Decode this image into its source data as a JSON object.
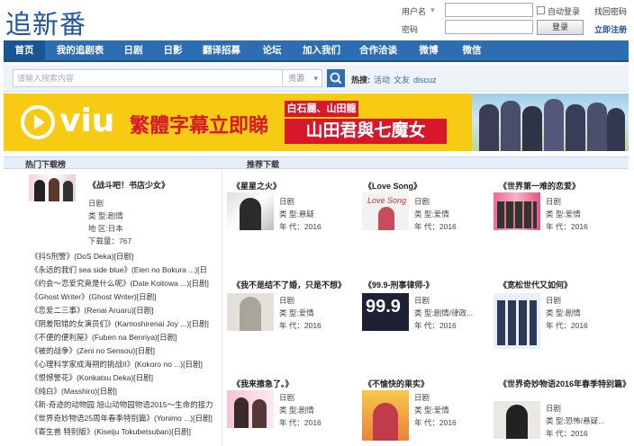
{
  "site": {
    "logo": "追新番"
  },
  "login": {
    "username_label": "用户名",
    "password_label": "密码",
    "remember_label": "自动登录",
    "login_button": "登录",
    "forgot_link": "找回密码",
    "register_link": "立即注册"
  },
  "nav": [
    "首页",
    "我的追剧表",
    "日剧",
    "日影",
    "翻译招募",
    "论坛",
    "加入我们",
    "合作洽谈",
    "微博",
    "微信"
  ],
  "search": {
    "placeholder": "请输入搜索内容",
    "type": "资源",
    "hot_label": "热搜:",
    "hot_terms": [
      "活动",
      "文友",
      "discuz"
    ]
  },
  "banner": {
    "brand": "viu",
    "tagline": "繁體字幕立即睇",
    "cast": "白石麗、山田龍",
    "show_title": "山田君與七魔女"
  },
  "sections": {
    "hot_downloads": "热门下载榜",
    "recommended": "推荐下载"
  },
  "featured": {
    "title": "《战斗吧！书店少女》",
    "genre": "日剧",
    "type_label": "类 型:剧情",
    "region_label": "地 区:日本",
    "downloads_label": "下载量：767"
  },
  "download_list": [
    "《抖S刑警》(DoS Deka)[日剧]",
    "《永远的我们 sea side blue》(Eien no Bokura ...)[日",
    "《约会～恋爱究竟是什么呢》(Date Koitowa ...)[日剧]",
    "《Ghost Writer》(Ghost Writer)[日剧]",
    "《恋爱二三事》(Renai Aruaru)[日剧]",
    "《阴差阳错的女演员们》(Kamoshirenai Joy ...)[日剧]",
    "《不便的便利屋》(Fuben na Benriya)[日剧]",
    "《被的战争》(Zeni no Sensou)[日剧]",
    "《心理科学家成海朔的挑战II》(Kokoro no ...)[日剧]",
    "《恨憾警花》(Konkatsu Deka)[日剧]",
    "《纯白》(Masshiro)[日剧]",
    "《新·奇迹的动物园 旭山动物园物语2015～生命的接力",
    "《世界奇妙物语25周年春季特别篇》(Yonimo ...)[日剧]",
    "《寄生兽 特别版》(Kiseiju Tokubetsuban)[日剧]"
  ],
  "cards": [
    {
      "title": "《星星之火》",
      "genre": "日剧",
      "type": "类 型:悬疑",
      "year": "年 代：2016"
    },
    {
      "title": "《Love Song》",
      "genre": "日剧",
      "type": "类 型:爱情",
      "year": "年 代：2016"
    },
    {
      "title": "《世界第一难的恋爱》",
      "genre": "日剧",
      "type": "类 型:爱情",
      "year": "年 代：2016"
    },
    {
      "title": "《我不是结不了婚，只是不想》",
      "genre": "日剧",
      "type": "类 型:爱情",
      "year": "年 代：2016"
    },
    {
      "title": "《99.9-刑事律师-》",
      "genre": "日剧",
      "type": "类 型:剧情/律政...",
      "year": "年 代：2016"
    },
    {
      "title": "《宽松世代又如何》",
      "genre": "日剧",
      "type": "类 型:剧情",
      "year": "年 代：2016"
    },
    {
      "title": "《我来擦急了。》",
      "genre": "日剧",
      "type": "类 型:剧情",
      "year": "年 代：2016"
    },
    {
      "title": "《不愉快的果实》",
      "genre": "日剧",
      "type": "类 型:爱情",
      "year": "年 代：2016"
    },
    {
      "title": "《世界奇妙物语2016年春季特别篇》",
      "genre": "日剧",
      "type": "类 型:恐怖/悬疑...",
      "year": "年 代：2016"
    }
  ],
  "colors": {
    "brand_blue": "#2d6db3",
    "banner_yellow": "#f7ca13",
    "banner_red": "#d8182a"
  }
}
